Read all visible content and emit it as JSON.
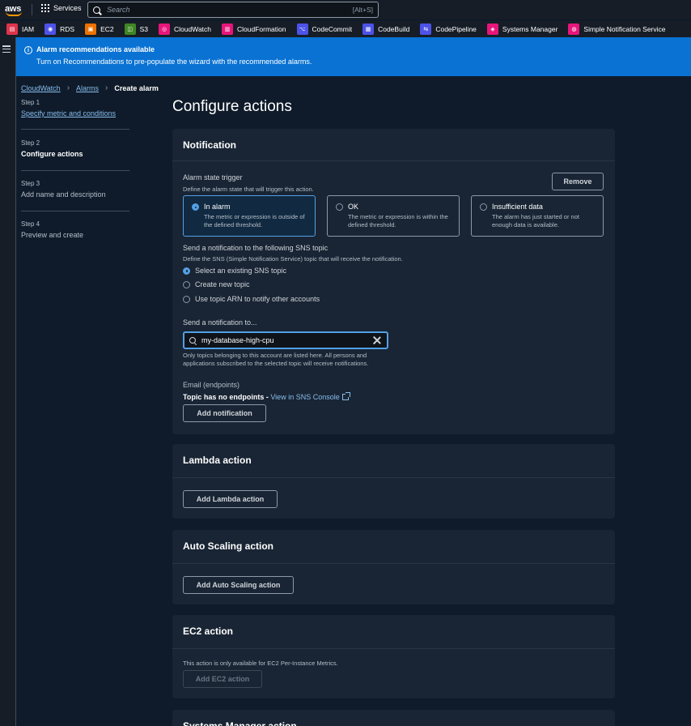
{
  "topbar": {
    "logo_text": "aws",
    "services_label": "Services",
    "search_placeholder": "Search",
    "search_shortcut": "[Alt+S]"
  },
  "favorites": [
    {
      "label": "IAM",
      "icon": "iam-icon",
      "color": "#dd344c",
      "glyph": "▤"
    },
    {
      "label": "RDS",
      "icon": "rds-icon",
      "color": "#4d53e8",
      "glyph": "◉"
    },
    {
      "label": "EC2",
      "icon": "ec2-icon",
      "color": "#ed7100",
      "glyph": "▣"
    },
    {
      "label": "S3",
      "icon": "s3-icon",
      "color": "#3f8624",
      "glyph": "◫"
    },
    {
      "label": "CloudWatch",
      "icon": "cloudwatch-icon",
      "color": "#e7157b",
      "glyph": "◎"
    },
    {
      "label": "CloudFormation",
      "icon": "cloudformation-icon",
      "color": "#e7157b",
      "glyph": "▥"
    },
    {
      "label": "CodeCommit",
      "icon": "codecommit-icon",
      "color": "#4d53e8",
      "glyph": "⌥"
    },
    {
      "label": "CodeBuild",
      "icon": "codebuild-icon",
      "color": "#4d53e8",
      "glyph": "▦"
    },
    {
      "label": "CodePipeline",
      "icon": "codepipeline-icon",
      "color": "#4d53e8",
      "glyph": "⇆"
    },
    {
      "label": "Systems Manager",
      "icon": "systems-manager-icon",
      "color": "#e7157b",
      "glyph": "◈"
    },
    {
      "label": "Simple Notification Service",
      "icon": "sns-icon",
      "color": "#e7157b",
      "glyph": "◍"
    }
  ],
  "banner": {
    "title": "Alarm recommendations available",
    "message": "Turn on Recommendations to pre-populate the wizard with the recommended alarms."
  },
  "breadcrumb": {
    "items": [
      "CloudWatch",
      "Alarms"
    ],
    "current": "Create alarm"
  },
  "steps": [
    {
      "number": "Step 1",
      "label": "Specify metric and conditions"
    },
    {
      "number": "Step 2",
      "label": "Configure actions"
    },
    {
      "number": "Step 3",
      "label": "Add name and description"
    },
    {
      "number": "Step 4",
      "label": "Preview and create"
    }
  ],
  "page_title": "Configure actions",
  "notification": {
    "title": "Notification",
    "remove_label": "Remove",
    "trigger_label": "Alarm state trigger",
    "trigger_desc": "Define the alarm state that will trigger this action.",
    "states": [
      {
        "title": "In alarm",
        "desc": "The metric or expression is outside of the defined threshold.",
        "selected": true
      },
      {
        "title": "OK",
        "desc": "The metric or expression is within the defined threshold.",
        "selected": false
      },
      {
        "title": "Insufficient data",
        "desc": "The alarm has just started or not enough data is available.",
        "selected": false
      }
    ],
    "sns_label": "Send a notification to the following SNS topic",
    "sns_desc": "Define the SNS (Simple Notification Service) topic that will receive the notification.",
    "sns_options": [
      {
        "label": "Select an existing SNS topic",
        "selected": true
      },
      {
        "label": "Create new topic",
        "selected": false
      },
      {
        "label": "Use topic ARN to notify other accounts",
        "selected": false
      }
    ],
    "send_to_label": "Send a notification to...",
    "topic_value": "my-database-high-cpu",
    "topic_help_1": "Only topics belonging to this account are listed here. All persons and",
    "topic_help_2": "applications subscribed to the selected topic will receive notifications.",
    "email_label": "Email (endpoints)",
    "no_endpoints": "Topic has no endpoints - ",
    "console_link": "View in SNS Console",
    "add_label": "Add notification"
  },
  "lambda": {
    "title": "Lambda action",
    "button": "Add Lambda action"
  },
  "autoscaling": {
    "title": "Auto Scaling action",
    "button": "Add Auto Scaling action"
  },
  "ec2": {
    "title": "EC2 action",
    "note": "This action is only available for EC2 Per-Instance Metrics.",
    "button": "Add EC2 action"
  },
  "ssm": {
    "title": "Systems Manager action"
  }
}
